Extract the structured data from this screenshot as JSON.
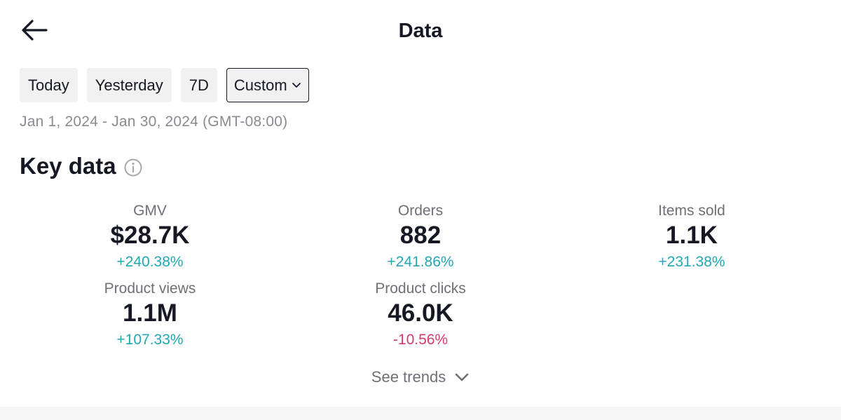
{
  "header": {
    "title": "Data",
    "back_icon": "arrow-left-icon"
  },
  "filters": {
    "items": [
      {
        "label": "Today",
        "selected": false
      },
      {
        "label": "Yesterday",
        "selected": false
      },
      {
        "label": "7D",
        "selected": false
      },
      {
        "label": "Custom",
        "selected": true,
        "icon": "chevron-down-icon"
      }
    ]
  },
  "date_range": "Jan 1, 2024 - Jan 30, 2024 (GMT-08:00)",
  "key_data": {
    "title": "Key data",
    "info_icon": "info-icon",
    "metrics": [
      {
        "label": "GMV",
        "value": "$28.7K",
        "change": "+240.38%",
        "trend": "up"
      },
      {
        "label": "Orders",
        "value": "882",
        "change": "+241.86%",
        "trend": "up"
      },
      {
        "label": "Items sold",
        "value": "1.1K",
        "change": "+231.38%",
        "trend": "up"
      },
      {
        "label": "Product views",
        "value": "1.1M",
        "change": "+107.33%",
        "trend": "up"
      },
      {
        "label": "Product clicks",
        "value": "46.0K",
        "change": "-10.56%",
        "trend": "down"
      }
    ]
  },
  "see_trends": {
    "label": "See trends",
    "icon": "chevron-down-icon"
  },
  "colors": {
    "positive": "#22a8b4",
    "negative": "#d73a68",
    "text_primary": "#161823",
    "text_secondary": "#6f7077",
    "chip_bg": "#f1f1f2"
  }
}
